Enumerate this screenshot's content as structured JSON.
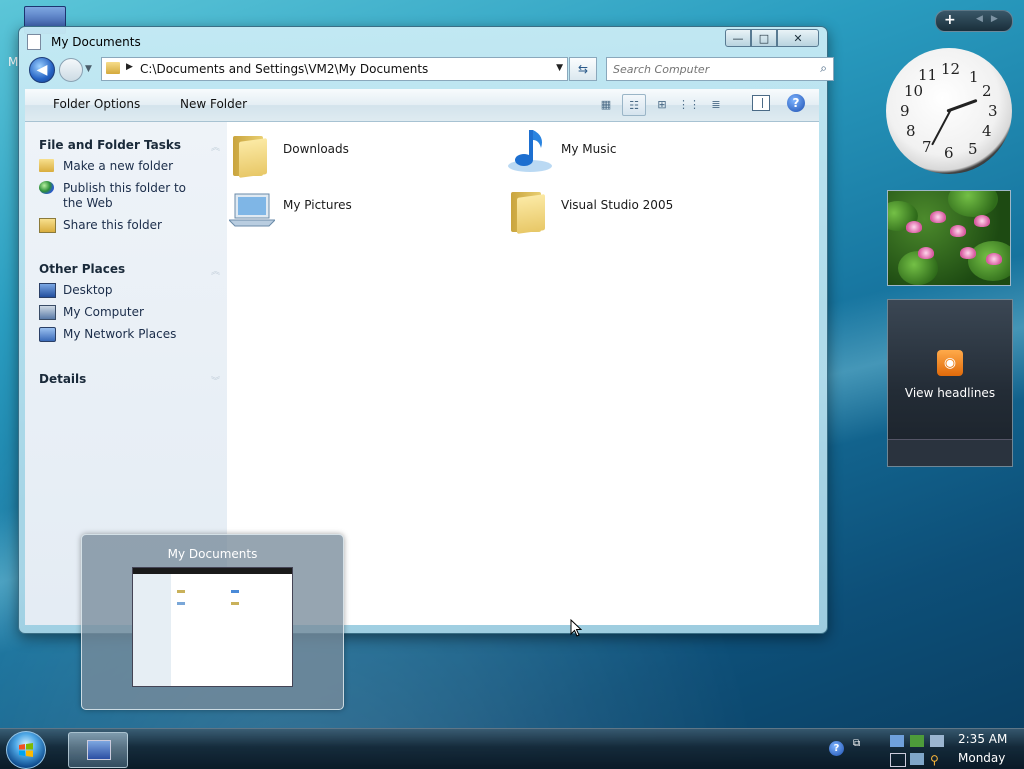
{
  "desktop": {
    "icon_partial_label": "M"
  },
  "window": {
    "title": "My Documents",
    "caption_buttons": {
      "minimize": "—",
      "maximize": "□",
      "close": "✕"
    },
    "address": {
      "path": "C:\\Documents and Settings\\VM2\\My Documents"
    },
    "search": {
      "placeholder": "Search Computer"
    },
    "toolbar": {
      "folder_options": "Folder Options",
      "new_folder": "New Folder"
    },
    "tasks": {
      "file_folder_title": "File and Folder Tasks",
      "file_folder_items": [
        {
          "label": "Make a new folder",
          "icon": "new-folder-icon"
        },
        {
          "label": "Publish this folder to the Web",
          "icon": "publish-globe-icon"
        },
        {
          "label": "Share this folder",
          "icon": "share-folder-icon"
        }
      ],
      "other_places_title": "Other Places",
      "other_places_items": [
        {
          "label": "Desktop",
          "icon": "desktop-icon"
        },
        {
          "label": "My Computer",
          "icon": "computer-icon"
        },
        {
          "label": "My Network Places",
          "icon": "network-icon"
        }
      ],
      "details_title": "Details"
    },
    "files": [
      {
        "name": "Downloads",
        "icon": "folder-icon"
      },
      {
        "name": "My Music",
        "icon": "music-icon"
      },
      {
        "name": "My Pictures",
        "icon": "pictures-icon"
      },
      {
        "name": "Visual Studio 2005",
        "icon": "folder-icon"
      }
    ]
  },
  "thumbnail_preview": {
    "title": "My Documents"
  },
  "sidebar": {
    "add_gadget": "+",
    "clock": {
      "numbers": [
        "12",
        "1",
        "2",
        "3",
        "4",
        "5",
        "6",
        "7",
        "8",
        "9",
        "10",
        "11"
      ]
    },
    "feed": {
      "label": "View headlines"
    }
  },
  "taskbar": {
    "clock_time": "2:35 AM",
    "clock_day": "Monday"
  },
  "colors": {
    "accent": "#2563c4",
    "taskbar": "#14283a",
    "feed_accent": "#e06a0a"
  }
}
